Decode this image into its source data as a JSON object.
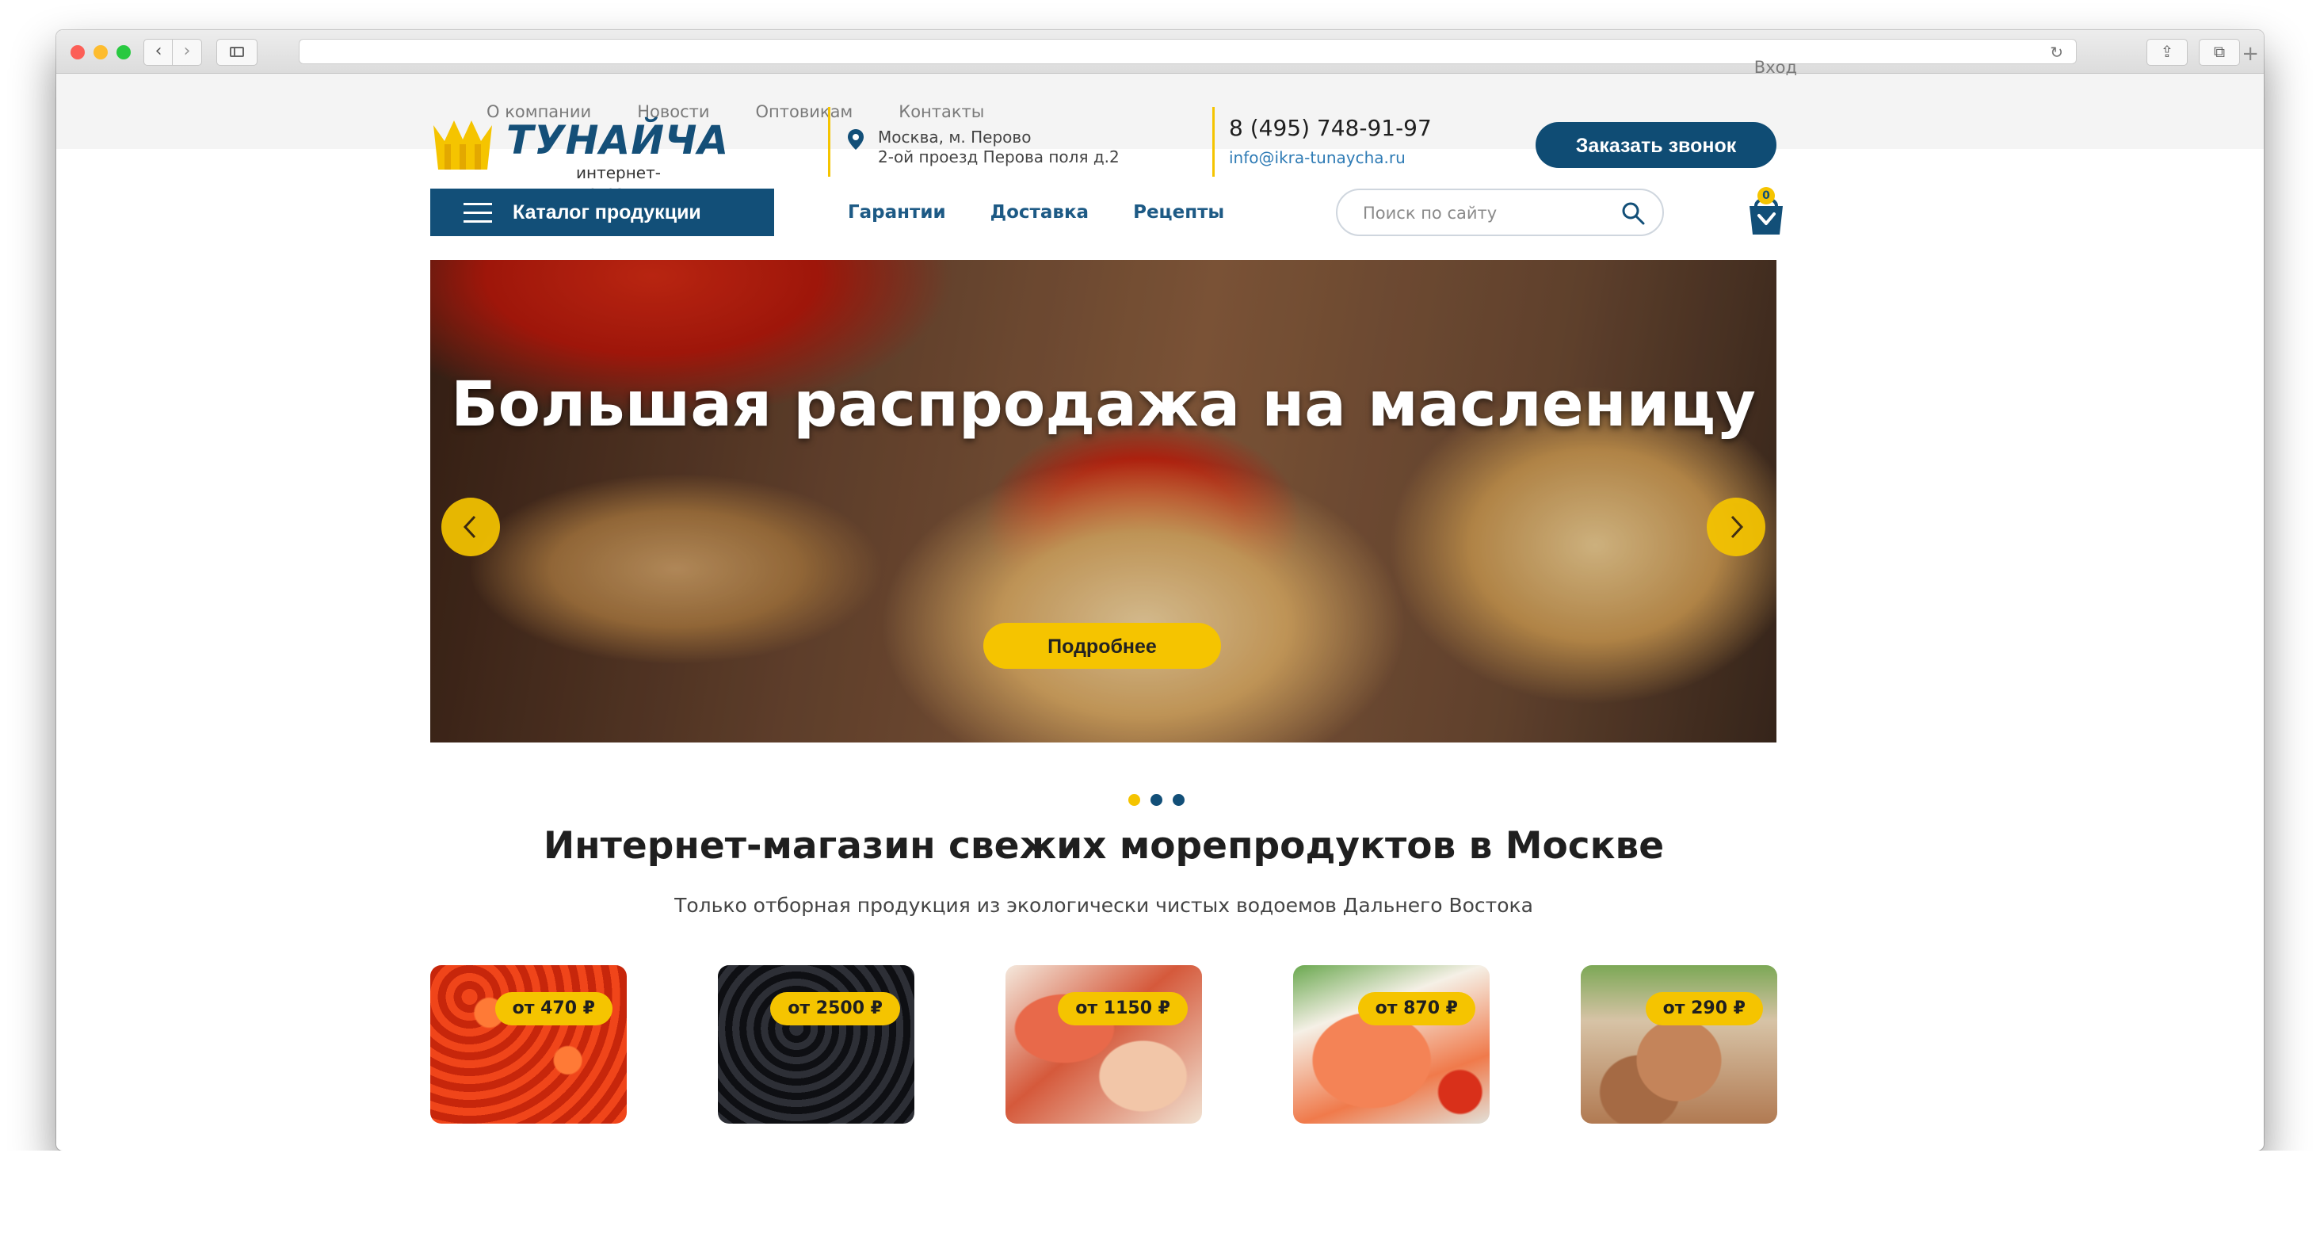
{
  "topnav": {
    "items": [
      "О компании",
      "Новости",
      "Оптовикам",
      "Контакты"
    ],
    "login": "Вход"
  },
  "header": {
    "logo_name": "ТУНАЙЧА",
    "logo_sub": "интернет-магазин",
    "address_line1": "Москва, м. Перово",
    "address_line2": "2-ой проезд Перова поля д.2",
    "phone": "8 (495) 748-91-97",
    "email": "info@ikra-tunaycha.ru",
    "callback_label": "Заказать звонок"
  },
  "navbar": {
    "catalog_label": "Каталог продукции",
    "links": [
      "Гарантии",
      "Доставка",
      "Рецепты"
    ],
    "search_placeholder": "Поиск по сайту",
    "cart_count": "0"
  },
  "hero": {
    "title": "Большая распродажа на масленицу",
    "button_label": "Подробнее",
    "slides_total": 3,
    "active_slide": 1
  },
  "intro": {
    "title": "Интернет-магазин свежих морепродуктов в Москве",
    "subtitle": "Только отборная продукция из экологически чистых водоемов Дальнего Востока"
  },
  "products": [
    {
      "price": "от 470 ₽"
    },
    {
      "price": "от 2500 ₽"
    },
    {
      "price": "от 1150 ₽"
    },
    {
      "price": "от 870 ₽"
    },
    {
      "price": "от 290 ₽"
    }
  ],
  "colors": {
    "brand_blue": "#124f78",
    "accent_yellow": "#f5c400"
  },
  "icons": {
    "cart": "shopping-bag-icon",
    "search": "magnifier-icon",
    "location": "pin-icon",
    "menu": "hamburger-icon"
  }
}
